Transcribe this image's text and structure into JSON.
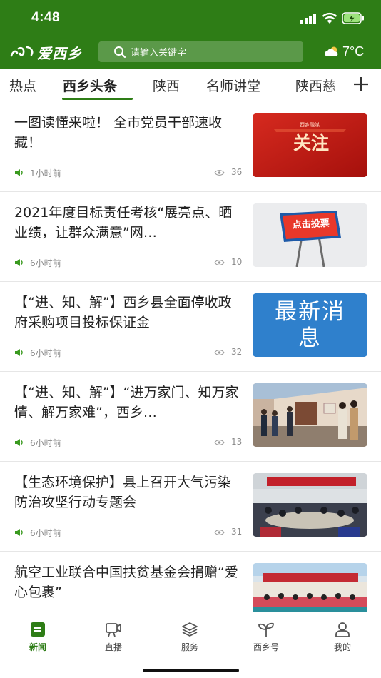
{
  "status_bar": {
    "time": "4:48",
    "icons": [
      "signal-icon",
      "wifi-icon",
      "battery-charging-icon"
    ]
  },
  "header": {
    "logo_text": "爱西乡",
    "search": {
      "placeholder": "请输入关键字"
    },
    "weather": {
      "icon": "partly-cloudy-icon",
      "temp": "7°C"
    }
  },
  "tabs": {
    "items": [
      {
        "label": "热点"
      },
      {
        "label": "西乡头条",
        "active": true
      },
      {
        "label": "陕西"
      },
      {
        "label": "名师讲堂"
      },
      {
        "label": "陕西慈"
      }
    ],
    "add_icon": "plus-icon"
  },
  "feed": {
    "items": [
      {
        "title": "一图读懂来啦！ 全市党员干部速收藏！",
        "time": "1小时前",
        "views": "36",
        "thumb_text": "关注",
        "thumb_subtext": "西乡融媒"
      },
      {
        "title": "2021年度目标责任考核“展亮点、晒业绩，让群众满意”网…",
        "time": "6小时前",
        "views": "10",
        "thumb_text": "点击投票"
      },
      {
        "title": "【“进、知、解”】西乡县全面停收政府采购项目投标保证金",
        "time": "6小时前",
        "views": "32",
        "thumb_text": "最新消息"
      },
      {
        "title": "【“进、知、解”】“进万家门、知万家情、解万家难”，西乡…",
        "time": "6小时前",
        "views": "13"
      },
      {
        "title": "【生态环境保护】县上召开大气污染防治攻坚行动专题会",
        "time": "6小时前",
        "views": "31"
      },
      {
        "title": "航空工业联合中国扶贫基金会捐赠“爱心包裹”"
      }
    ]
  },
  "bottom_nav": {
    "items": [
      {
        "label": "新闻",
        "icon": "news-icon",
        "active": true
      },
      {
        "label": "直播",
        "icon": "live-icon"
      },
      {
        "label": "服务",
        "icon": "services-icon"
      },
      {
        "label": "西乡号",
        "icon": "sprout-icon"
      },
      {
        "label": "我的",
        "icon": "profile-icon"
      }
    ]
  },
  "colors": {
    "brand_green": "#2e7d16",
    "text": "#222222",
    "meta": "#8a8a8a"
  }
}
